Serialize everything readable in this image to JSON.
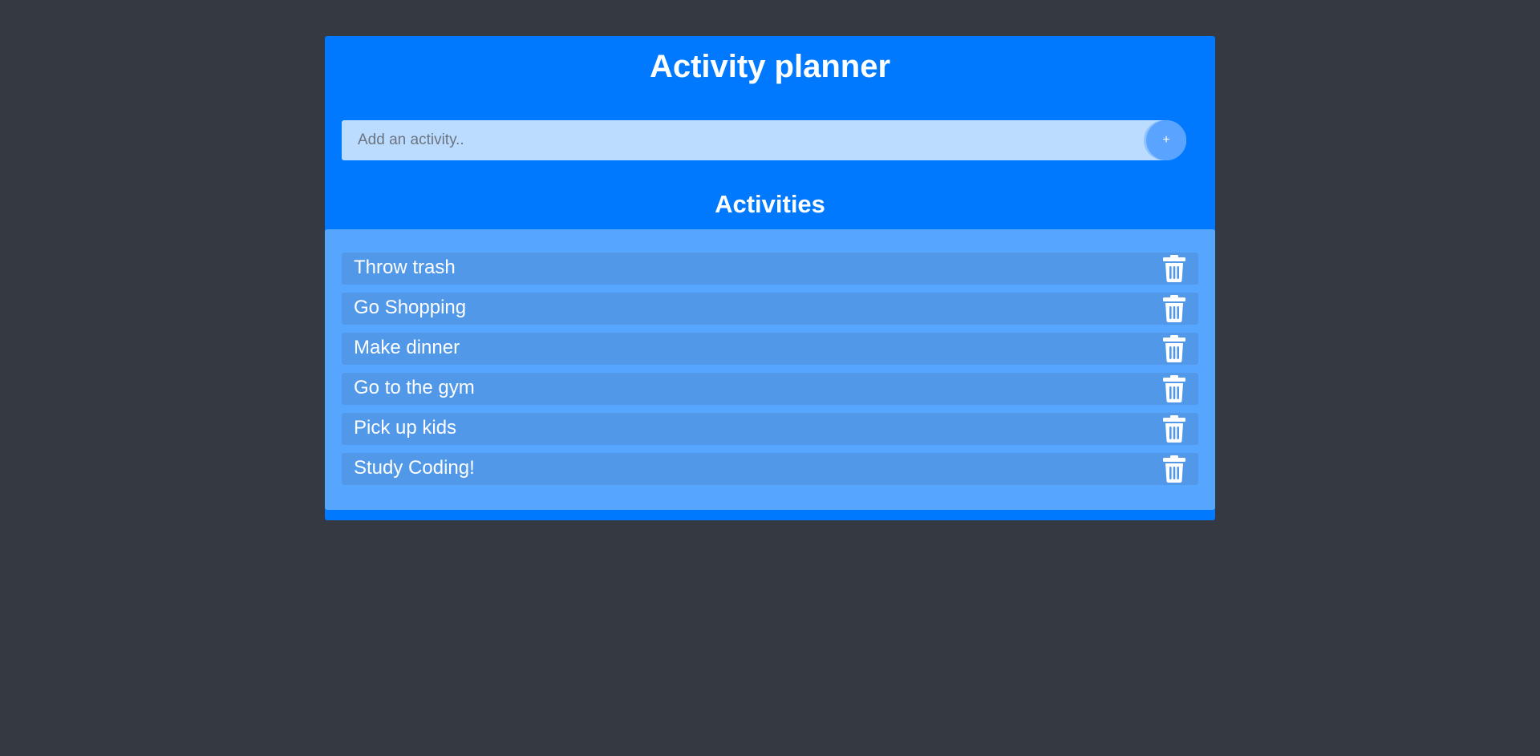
{
  "app": {
    "title": "Activity planner"
  },
  "add_form": {
    "placeholder": "Add an activity..",
    "value": "",
    "add_button_label": "+"
  },
  "activities": {
    "heading": "Activities",
    "items": [
      {
        "label": "Throw trash",
        "icon": "trash-icon"
      },
      {
        "label": "Go Shopping",
        "icon": "trash-icon"
      },
      {
        "label": "Make dinner",
        "icon": "trash-icon"
      },
      {
        "label": "Go to the gym",
        "icon": "trash-icon"
      },
      {
        "label": "Pick up kids",
        "icon": "trash-icon"
      },
      {
        "label": "Study Coding!",
        "icon": "trash-icon"
      }
    ]
  },
  "colors": {
    "background": "#353941",
    "app_blue": "#0079ff",
    "panel_blue": "#56a6ff",
    "item_blue": "#5198e8",
    "input_bg": "#bbdcff",
    "button_blue": "#5aa4ff"
  }
}
